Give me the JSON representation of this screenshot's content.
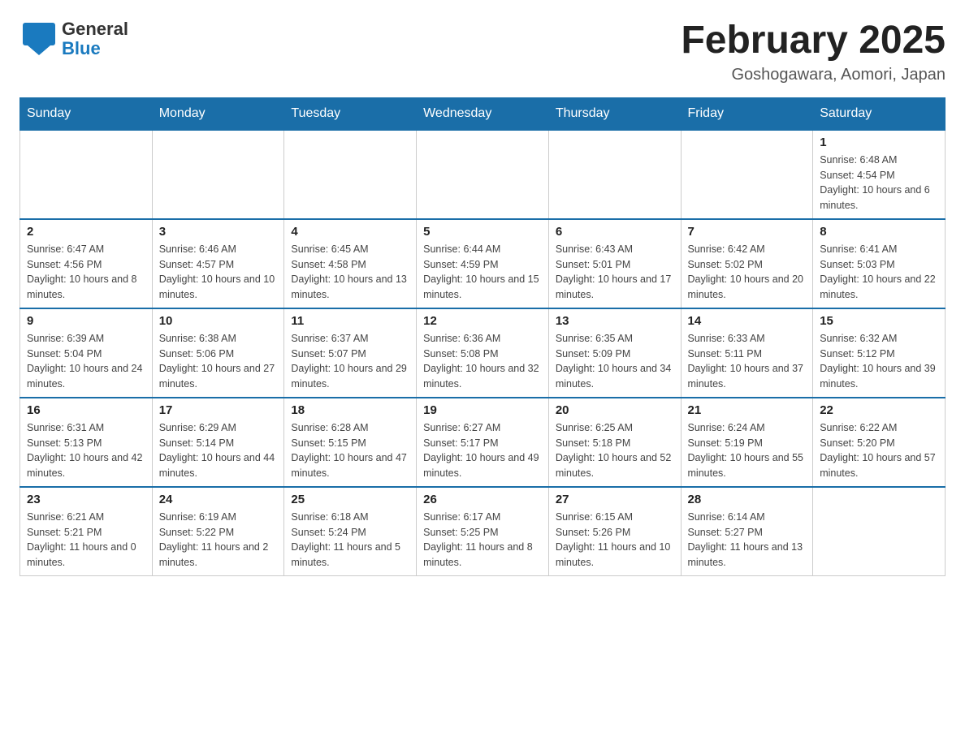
{
  "logo": {
    "general": "General",
    "blue": "Blue"
  },
  "title": "February 2025",
  "location": "Goshogawara, Aomori, Japan",
  "weekdays": [
    "Sunday",
    "Monday",
    "Tuesday",
    "Wednesday",
    "Thursday",
    "Friday",
    "Saturday"
  ],
  "weeks": [
    [
      {
        "day": "",
        "info": ""
      },
      {
        "day": "",
        "info": ""
      },
      {
        "day": "",
        "info": ""
      },
      {
        "day": "",
        "info": ""
      },
      {
        "day": "",
        "info": ""
      },
      {
        "day": "",
        "info": ""
      },
      {
        "day": "1",
        "info": "Sunrise: 6:48 AM\nSunset: 4:54 PM\nDaylight: 10 hours and 6 minutes."
      }
    ],
    [
      {
        "day": "2",
        "info": "Sunrise: 6:47 AM\nSunset: 4:56 PM\nDaylight: 10 hours and 8 minutes."
      },
      {
        "day": "3",
        "info": "Sunrise: 6:46 AM\nSunset: 4:57 PM\nDaylight: 10 hours and 10 minutes."
      },
      {
        "day": "4",
        "info": "Sunrise: 6:45 AM\nSunset: 4:58 PM\nDaylight: 10 hours and 13 minutes."
      },
      {
        "day": "5",
        "info": "Sunrise: 6:44 AM\nSunset: 4:59 PM\nDaylight: 10 hours and 15 minutes."
      },
      {
        "day": "6",
        "info": "Sunrise: 6:43 AM\nSunset: 5:01 PM\nDaylight: 10 hours and 17 minutes."
      },
      {
        "day": "7",
        "info": "Sunrise: 6:42 AM\nSunset: 5:02 PM\nDaylight: 10 hours and 20 minutes."
      },
      {
        "day": "8",
        "info": "Sunrise: 6:41 AM\nSunset: 5:03 PM\nDaylight: 10 hours and 22 minutes."
      }
    ],
    [
      {
        "day": "9",
        "info": "Sunrise: 6:39 AM\nSunset: 5:04 PM\nDaylight: 10 hours and 24 minutes."
      },
      {
        "day": "10",
        "info": "Sunrise: 6:38 AM\nSunset: 5:06 PM\nDaylight: 10 hours and 27 minutes."
      },
      {
        "day": "11",
        "info": "Sunrise: 6:37 AM\nSunset: 5:07 PM\nDaylight: 10 hours and 29 minutes."
      },
      {
        "day": "12",
        "info": "Sunrise: 6:36 AM\nSunset: 5:08 PM\nDaylight: 10 hours and 32 minutes."
      },
      {
        "day": "13",
        "info": "Sunrise: 6:35 AM\nSunset: 5:09 PM\nDaylight: 10 hours and 34 minutes."
      },
      {
        "day": "14",
        "info": "Sunrise: 6:33 AM\nSunset: 5:11 PM\nDaylight: 10 hours and 37 minutes."
      },
      {
        "day": "15",
        "info": "Sunrise: 6:32 AM\nSunset: 5:12 PM\nDaylight: 10 hours and 39 minutes."
      }
    ],
    [
      {
        "day": "16",
        "info": "Sunrise: 6:31 AM\nSunset: 5:13 PM\nDaylight: 10 hours and 42 minutes."
      },
      {
        "day": "17",
        "info": "Sunrise: 6:29 AM\nSunset: 5:14 PM\nDaylight: 10 hours and 44 minutes."
      },
      {
        "day": "18",
        "info": "Sunrise: 6:28 AM\nSunset: 5:15 PM\nDaylight: 10 hours and 47 minutes."
      },
      {
        "day": "19",
        "info": "Sunrise: 6:27 AM\nSunset: 5:17 PM\nDaylight: 10 hours and 49 minutes."
      },
      {
        "day": "20",
        "info": "Sunrise: 6:25 AM\nSunset: 5:18 PM\nDaylight: 10 hours and 52 minutes."
      },
      {
        "day": "21",
        "info": "Sunrise: 6:24 AM\nSunset: 5:19 PM\nDaylight: 10 hours and 55 minutes."
      },
      {
        "day": "22",
        "info": "Sunrise: 6:22 AM\nSunset: 5:20 PM\nDaylight: 10 hours and 57 minutes."
      }
    ],
    [
      {
        "day": "23",
        "info": "Sunrise: 6:21 AM\nSunset: 5:21 PM\nDaylight: 11 hours and 0 minutes."
      },
      {
        "day": "24",
        "info": "Sunrise: 6:19 AM\nSunset: 5:22 PM\nDaylight: 11 hours and 2 minutes."
      },
      {
        "day": "25",
        "info": "Sunrise: 6:18 AM\nSunset: 5:24 PM\nDaylight: 11 hours and 5 minutes."
      },
      {
        "day": "26",
        "info": "Sunrise: 6:17 AM\nSunset: 5:25 PM\nDaylight: 11 hours and 8 minutes."
      },
      {
        "day": "27",
        "info": "Sunrise: 6:15 AM\nSunset: 5:26 PM\nDaylight: 11 hours and 10 minutes."
      },
      {
        "day": "28",
        "info": "Sunrise: 6:14 AM\nSunset: 5:27 PM\nDaylight: 11 hours and 13 minutes."
      },
      {
        "day": "",
        "info": ""
      }
    ]
  ]
}
